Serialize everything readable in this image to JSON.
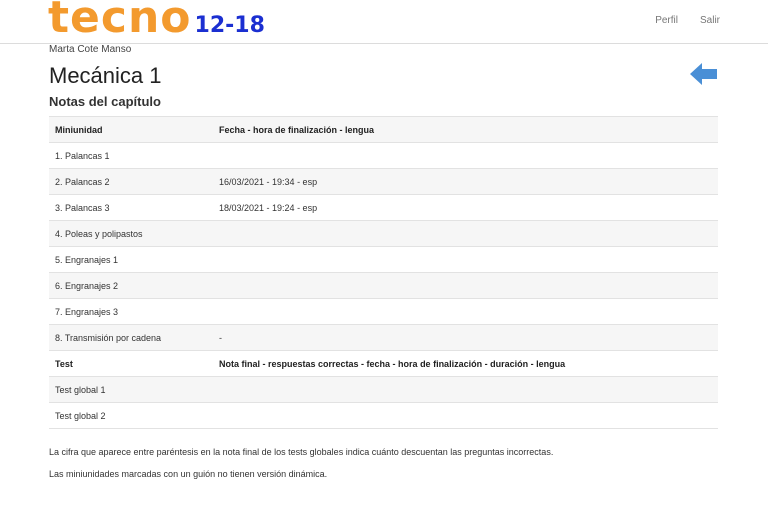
{
  "header": {
    "logo_main": "tecno",
    "logo_sub": "12-18",
    "nav": [
      "Perfil",
      "Salir"
    ]
  },
  "user_name": "Marta Cote Manso",
  "page_title": "Mecánica 1",
  "section_title": "Notas del capítulo",
  "units_table": {
    "headers": [
      "Miniunidad",
      "Fecha - hora de finalización - lengua"
    ],
    "rows": [
      [
        "1. Palancas 1",
        ""
      ],
      [
        "2. Palancas 2",
        "16/03/2021 - 19:34 - esp"
      ],
      [
        "3. Palancas 3",
        "18/03/2021 - 19:24 - esp"
      ],
      [
        "4. Poleas y polipastos",
        ""
      ],
      [
        "5. Engranajes 1",
        ""
      ],
      [
        "6. Engranajes 2",
        ""
      ],
      [
        "7. Engranajes 3",
        ""
      ],
      [
        "8. Transmisión por cadena",
        "-"
      ]
    ]
  },
  "test_table": {
    "headers": [
      "Test",
      "Nota final - respuestas correctas - fecha - hora de finalización - duración - lengua"
    ],
    "rows": [
      [
        "Test global 1",
        ""
      ],
      [
        "Test global 2",
        ""
      ]
    ]
  },
  "notes": [
    "La cifra que aparece entre paréntesis en la nota final de los tests globales indica cuánto descuentan las preguntas incorrectas.",
    "Las miniunidades marcadas con un guión no tienen versión dinámica."
  ],
  "icons": {
    "back": "arrow-left-icon"
  },
  "colors": {
    "logo_main": "#f39a2e",
    "logo_sub": "#1b2fd1",
    "back_arrow": "#4a8fd6"
  }
}
